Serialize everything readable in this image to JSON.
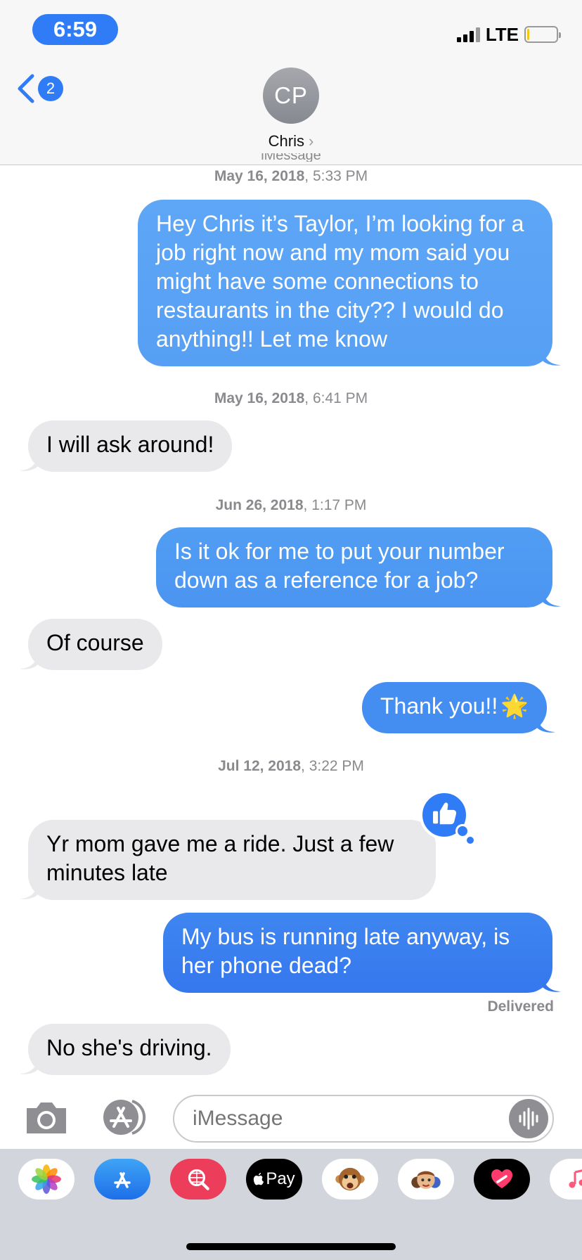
{
  "status_bar": {
    "time": "6:59",
    "network": "LTE"
  },
  "nav": {
    "back_badge": "2",
    "contact_initials": "CP",
    "contact_name": "Chris",
    "chevron": "›"
  },
  "service_label": "iMessage",
  "messages": [
    {
      "type": "timestamp",
      "date": "May 16, 2018",
      "time": "5:33 PM"
    },
    {
      "type": "sent",
      "text": "Hey Chris it’s Taylor, I’m looking for a job right now and my mom said you might have some connections to restaurants in the city?? I would do anything!! Let me know"
    },
    {
      "type": "timestamp",
      "date": "May 16, 2018",
      "time": "6:41 PM"
    },
    {
      "type": "received",
      "text": "I will ask around!"
    },
    {
      "type": "timestamp",
      "date": "Jun 26, 2018",
      "time": "1:17 PM"
    },
    {
      "type": "sent",
      "text": "Is it ok for me to put your number down as a reference for a job?"
    },
    {
      "type": "received",
      "text": "Of course"
    },
    {
      "type": "sent",
      "text": "Thank you!!",
      "emoji": "🌟"
    },
    {
      "type": "timestamp",
      "date": "Jul 12, 2018",
      "time": "3:22 PM"
    },
    {
      "type": "received",
      "text": "Yr mom gave me a ride. Just a few minutes late",
      "tapback": "thumbs-up-icon"
    },
    {
      "type": "sent",
      "text": "My bus is running late anyway, is her phone dead?"
    },
    {
      "type": "receipt",
      "text": "Delivered"
    },
    {
      "type": "received",
      "text": "No she's driving."
    }
  ],
  "compose": {
    "placeholder": "iMessage"
  },
  "app_drawer": {
    "apps": [
      "photos-icon",
      "app-store-icon",
      "images-search-icon",
      "apple-pay-icon",
      "monkey-animoji-icon",
      "memoji-icon",
      "digital-touch-icon",
      "music-icon"
    ],
    "apple_pay_label": "Pay"
  },
  "colors": {
    "sent_bubble_top": "#5ba3f5",
    "sent_bubble_bottom": "#2f6ef0",
    "received_bubble": "#e9e9eb",
    "accent": "#2f7cf6"
  }
}
